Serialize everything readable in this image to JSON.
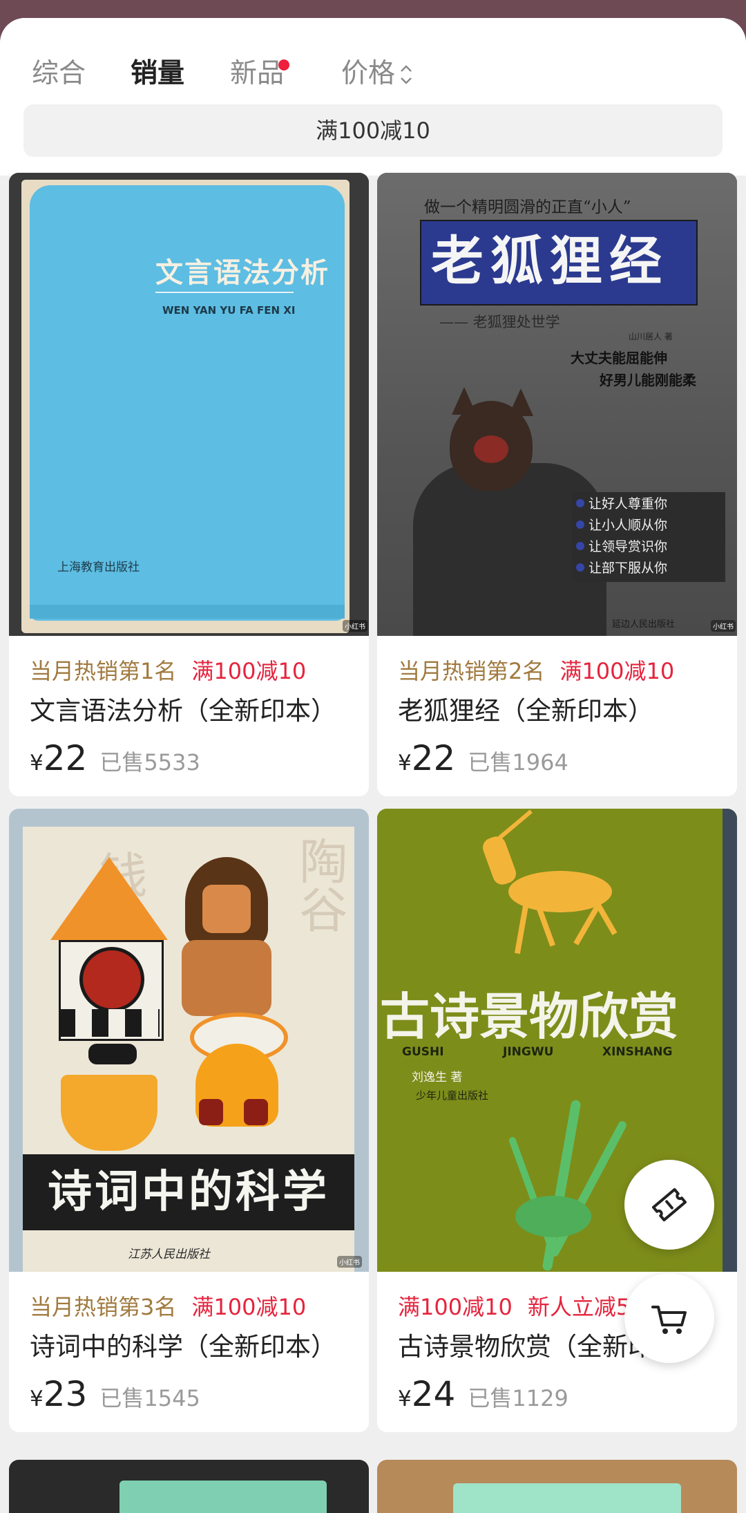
{
  "tabs": [
    {
      "label": "综合"
    },
    {
      "label": "销量"
    },
    {
      "label": "新品"
    },
    {
      "label": "价格"
    }
  ],
  "promo_banner": "满100减10",
  "colors": {
    "accent": "#ee1e3c",
    "rank_gold": "#a07a3f",
    "backdrop": "#6e4a55"
  },
  "products": [
    {
      "rank": "当月热销第1名",
      "promo": "满100减10",
      "title": "文言语法分析（全新印本）",
      "yen": "¥",
      "price": "22",
      "sold": "已售5533",
      "cover": {
        "title": "文言语法分析",
        "pinyin": "WEN YAN YU FA FEN XI",
        "publisher": "上海教育出版社",
        "tag": "小红书"
      }
    },
    {
      "rank": "当月热销第2名",
      "promo": "满100减10",
      "title": "老狐狸经（全新印本）",
      "yen": "¥",
      "price": "22",
      "sold": "已售1964",
      "cover": {
        "tagline": "做一个精明圆滑的正直“小人”",
        "title": "老狐狸经",
        "subtitle": "—— 老狐狸处世学",
        "author": "山川居人 著",
        "slogan_1": "大丈夫能屈能伸",
        "slogan_2": "好男儿能刚能柔",
        "bullets": [
          "让好人尊重你",
          "让小人顺从你",
          "让领导赏识你",
          "让部下服从你"
        ],
        "publisher": "延边人民出版社",
        "tag": "小红书"
      }
    },
    {
      "rank": "当月热销第3名",
      "promo": "满100减10",
      "title": "诗词中的科学（全新印本）",
      "yen": "¥",
      "price": "23",
      "sold": "已售1545",
      "cover": {
        "title": "诗词中的科学",
        "publisher": "江苏人民出版社",
        "tag": "小红书",
        "bg_chars_1": "钱十五",
        "bg_chars_2": "陶谷"
      }
    },
    {
      "rank": "满100减10",
      "promo": "新人立减5",
      "title": "古诗景物欣赏（全新印本）",
      "yen": "¥",
      "price": "24",
      "sold": "已售1129",
      "cover": {
        "title": "古诗景物欣赏",
        "pinyin_1": "GUSHI",
        "pinyin_2": "JINGWU",
        "pinyin_3": "XINSHANG",
        "author": "刘逸生 著",
        "publisher": "少年儿童出版社"
      }
    }
  ],
  "icons": {
    "coupon": "ticket-icon",
    "cart": "cart-icon",
    "sort": "sort-arrows-icon"
  }
}
